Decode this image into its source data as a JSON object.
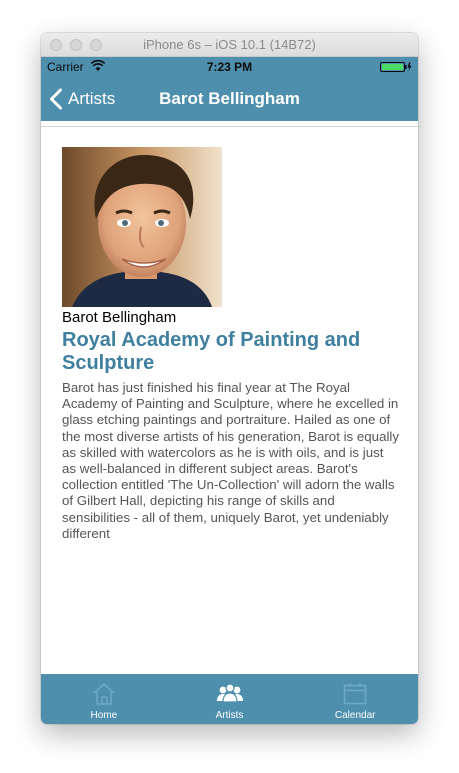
{
  "simulator": {
    "title": "iPhone 6s – iOS 10.1 (14B72)"
  },
  "statusbar": {
    "carrier": "Carrier",
    "time": "7:23 PM",
    "battery_color": "#4cd964"
  },
  "navbar": {
    "back_label": "Artists",
    "title": "Barot Bellingham"
  },
  "artist": {
    "name": "Barot Bellingham",
    "academy": "Royal Academy of Painting and Sculpture",
    "bio": "Barot has just finished his final year at The Royal Academy of Painting and Sculpture, where he excelled in glass etching paintings and portraiture. Hailed as one of the most diverse artists of his generation, Barot is equally as skilled with watercolors as he is with oils, and is just as well-balanced in different subject areas. Barot's collection entitled 'The Un-Collection' will adorn the walls of Gilbert Hall, depicting his range of skills and sensibilities - all of them, uniquely Barot, yet undeniably different"
  },
  "tabs": [
    {
      "label": "Home",
      "icon": "home-icon",
      "active": false
    },
    {
      "label": "Artists",
      "icon": "people-icon",
      "active": true
    },
    {
      "label": "Calendar",
      "icon": "calendar-icon",
      "active": false
    }
  ],
  "colors": {
    "accent": "#4e8fae",
    "heading": "#3f7f9f"
  }
}
